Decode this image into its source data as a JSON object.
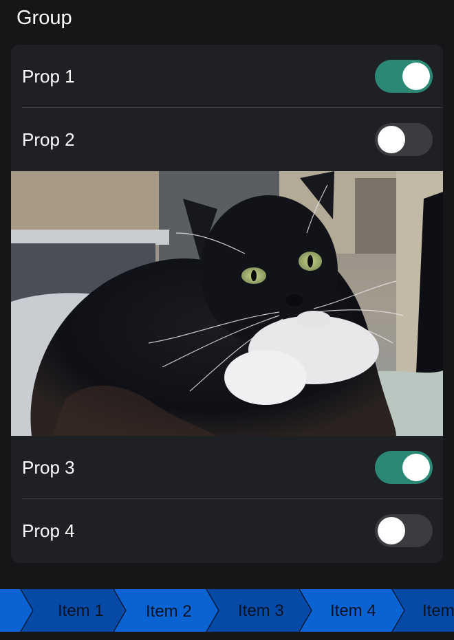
{
  "group": {
    "title": "Group"
  },
  "props": [
    {
      "label": "Prop 1",
      "on": true
    },
    {
      "label": "Prop 2",
      "on": false
    },
    {
      "label": "Prop 3",
      "on": true
    },
    {
      "label": "Prop 4",
      "on": false
    }
  ],
  "colors": {
    "background": "#151618",
    "card": "#1f2023",
    "toggle_on": "#2a8874",
    "toggle_off": "#3a3c40",
    "segment_dark": "#064aa8",
    "segment_light": "#0a63d2"
  },
  "breadcrumb": {
    "items": [
      "Item 1",
      "Item 2",
      "Item 3",
      "Item 4",
      "Item"
    ]
  }
}
